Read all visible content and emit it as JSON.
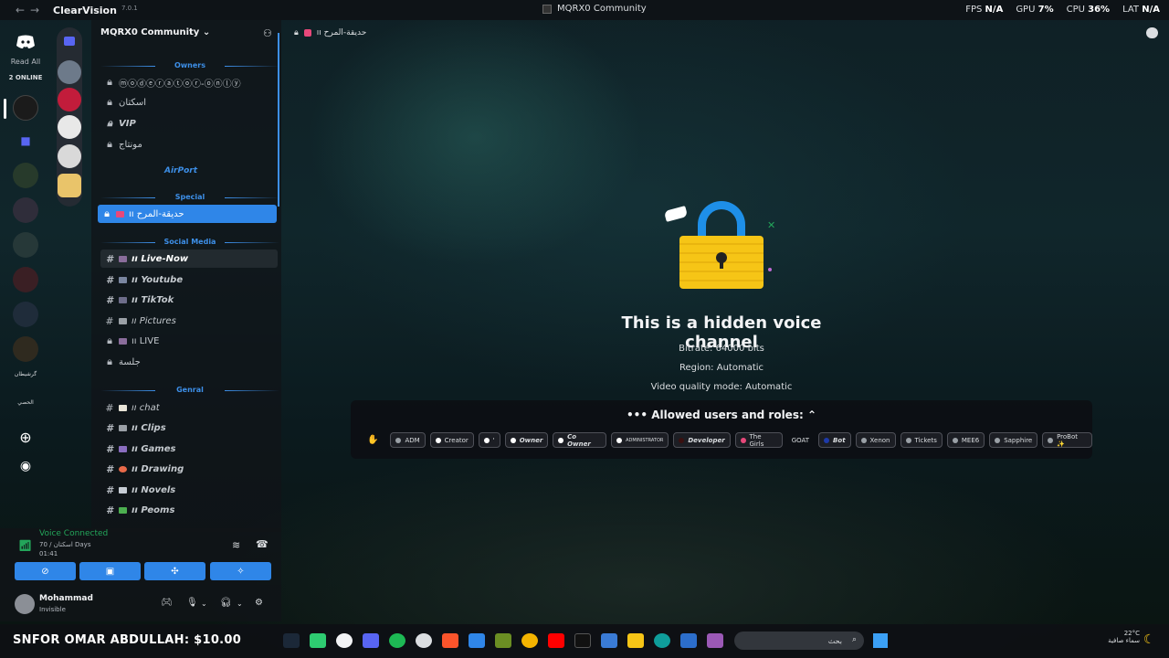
{
  "titlebar": {
    "app_name": "ClearVision",
    "app_version": "7.0.1",
    "window_title": "MQRX0 Community",
    "stats": [
      {
        "label": "FPS",
        "value": "N/A"
      },
      {
        "label": "GPU",
        "value": "7%"
      },
      {
        "label": "CPU",
        "value": "36%"
      },
      {
        "label": "LAT",
        "value": "N/A"
      }
    ]
  },
  "guilds": {
    "read_all": "Read All",
    "online_count": "2 ONLINE",
    "label_1": "گرشیطان",
    "label_2": "الحصي"
  },
  "server": {
    "name": "MQRX0 Community",
    "categories": {
      "owners": "Owners",
      "special": "Special",
      "social": "Social Media",
      "general": "Genral"
    },
    "airport": "AirPort",
    "owners_channels": [
      "ⓜⓞⓓⓔⓡⓐⓣⓞⓡ-ⓞⓝⓛⓨ",
      "اسكتان",
      "VIP",
      "مونتاج"
    ],
    "special_channel": "ıı حديقة-المرح",
    "social_channels": [
      "ıı Live-Now",
      "ıı Youtube",
      "ıı TikTok",
      "ıı Pictures",
      "ıı LIVE",
      "جلسة"
    ],
    "general_channels": [
      "ıı chat",
      "ıı Clips",
      "ıı Games",
      "ıı Drawing",
      "ıı Novels",
      "ıı Peoms"
    ]
  },
  "main": {
    "channel_header": "ıı حديقة-المرح",
    "hidden_title": "This is a hidden voice channel",
    "bitrate": "Bitrate: 64000 bits",
    "region": "Region: Automatic",
    "video_quality": "Video quality mode: Automatic",
    "allowed_title": "Allowed users and roles:",
    "allowed_prefix": "•••",
    "roles": [
      {
        "name": "ADM",
        "color": "#9aa0a6",
        "style": ""
      },
      {
        "name": "Creator",
        "color": "#ffffff",
        "style": ""
      },
      {
        "name": "'",
        "color": "#ffffff",
        "style": ""
      },
      {
        "name": "Owner",
        "color": "#ffffff",
        "style": "bi"
      },
      {
        "name": "Co Owner",
        "color": "#ffffff",
        "style": "bi"
      },
      {
        "name": "ADMINISTRATOR",
        "color": "#ffffff",
        "style": ""
      },
      {
        "name": "Developer",
        "color": "#3a1010",
        "style": "bi"
      },
      {
        "name": "The Girls",
        "color": "#e8487a",
        "style": ""
      },
      {
        "name": "GOAT",
        "color": "",
        "style": ""
      },
      {
        "name": "Bot",
        "color": "#1e3aa8",
        "style": "bi"
      },
      {
        "name": "Xenon",
        "color": "#9aa0a6",
        "style": ""
      },
      {
        "name": "Tickets",
        "color": "#9aa0a6",
        "style": ""
      },
      {
        "name": "MEE6",
        "color": "#9aa0a6",
        "style": ""
      },
      {
        "name": "Sapphire",
        "color": "#9aa0a6",
        "style": ""
      },
      {
        "name": "ProBot ✨",
        "color": "#9aa0a6",
        "style": ""
      }
    ]
  },
  "voice": {
    "status": "Voice Connected",
    "channel": "70 / اسكتان Days",
    "time": "01:41"
  },
  "user": {
    "name": "Mohammad",
    "status": "Invisible"
  },
  "taskbar": {
    "donation": "SNFOR OMAR ABDULLAH: $10.00",
    "search_placeholder": "بحث",
    "temp": "22°C",
    "weather": "سماء صافية"
  },
  "colors": {
    "accent": "#2f86e8",
    "voice_green": "#23a55a",
    "lock_yellow": "#f6c516"
  }
}
